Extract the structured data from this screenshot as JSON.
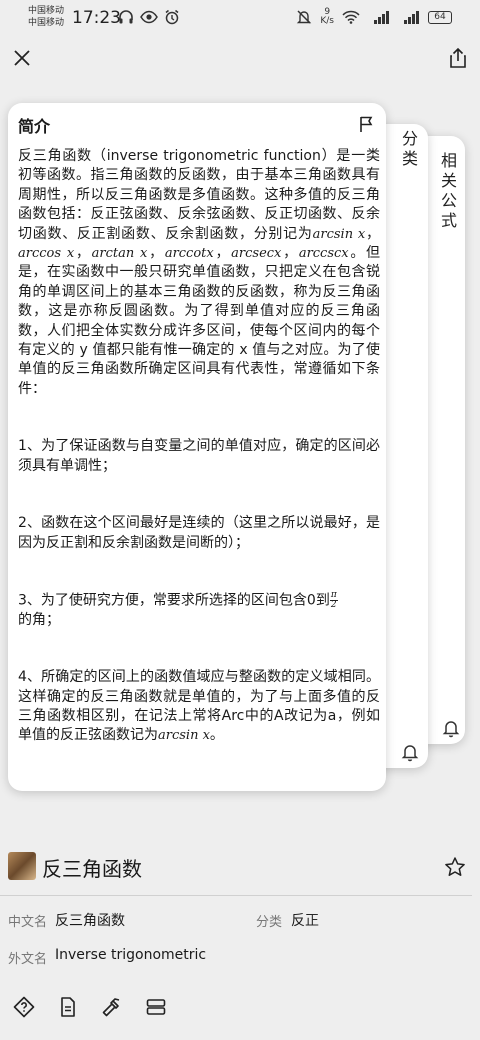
{
  "status_bar": {
    "carrier_1": "中国移动",
    "carrier_2": "中国移动",
    "time": "17:23",
    "net_speed_value": "9",
    "net_speed_unit": "K/s",
    "battery": "64"
  },
  "cards": {
    "category_title": "分类",
    "formula_title": "相关公式",
    "intro": {
      "title": "简介",
      "p1_a": "反三角函数（inverse trigonometric function）是一类初等函数。指三角函数的反函数，由于基本三角函数具有周期性，所以反三角函数是多值函数。这种多值的反三角函数包括：反正弦函数、反余弦函数、反正切函数、反余切函数、反正割函数、反余割函数，分别记为",
      "m_arcsin": "arcsin x",
      "m_arccos": "arccos x",
      "m_arctan": "arctan x",
      "m_arccot": "arccotx",
      "m_arcsec": "arcsecx",
      "m_arccsc": "arccscx",
      "p1_b": "。但是，在实函数中一般只研究单值函数，只把定义在包含锐角的单调区间上的基本三角函数的反函数，称为反三角函数，这是亦称反圆函数。为了得到单值对应的反三角函数，人们把全体实数分成许多区间，使每个区间内的每个有定义的 y 值都只能有惟一确定的 x 值与之对应。为了使单值的反三角函数所确定区间具有代表性，常遵循如下条件：",
      "p2": "1、为了保证函数与自变量之间的单值对应，确定的区间必须具有单调性；",
      "p3": "2、函数在这个区间最好是连续的（这里之所以说最好，是因为反正割和反余割函数是间断的）；",
      "p4_a": "3、为了使研究方便，常要求所选择的区间包含0到",
      "p4_pi": "π",
      "p4_den": "2",
      "p4_b": "的角；",
      "p5_a": "4、所确定的区间上的函数值域应与整函数的定义域相同。这样确定的反三角函数就是单值的，为了与上面多值的反三角函数相区别，在记法上常将Arc中的A改记为a，例如单值的反正弦函数记为",
      "p5_math": "arcsin x",
      "p5_b": "。"
    }
  },
  "entry": {
    "name": "反三角函数",
    "cn_label": "中文名",
    "cn_value": "反三角函数",
    "cat_label": "分类",
    "cat_value": "反正",
    "foreign_label": "外文名",
    "foreign_value": "Inverse trigonometric"
  }
}
